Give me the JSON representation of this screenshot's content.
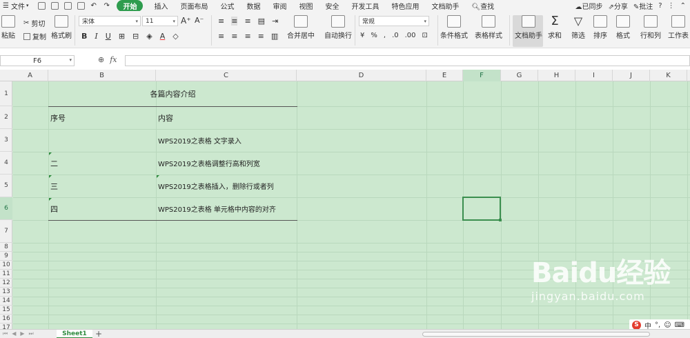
{
  "menubar": {
    "file_label": "文件",
    "start_tab": "开始",
    "tabs": [
      "插入",
      "页面布局",
      "公式",
      "数据",
      "审阅",
      "视图",
      "安全",
      "开发工具",
      "特色应用",
      "文档助手"
    ],
    "search_label": "查找",
    "sync_label": "已同步",
    "share_label": "分享",
    "comment_label": "批注",
    "help_label": "?"
  },
  "ribbon": {
    "paste_label": "粘贴",
    "cut_label": "剪切",
    "copy_label": "复制",
    "format_painter_label": "格式刷",
    "font_name": "宋体",
    "font_size": "11",
    "bold": "B",
    "italic": "I",
    "underline": "U",
    "merge_label": "合并居中",
    "wrap_label": "自动换行",
    "number_format": "常规",
    "cond_format_label": "条件格式",
    "table_style_label": "表格样式",
    "doc_helper_label": "文档助手",
    "sum_label": "求和",
    "filter_label": "筛选",
    "sort_label": "排序",
    "format_label": "格式",
    "rowcol_label": "行和列",
    "worksheet_label": "工作表"
  },
  "formula_bar": {
    "cell_ref": "F6",
    "fx": "fx",
    "value": ""
  },
  "sheet": {
    "columns": [
      "A",
      "B",
      "C",
      "D",
      "E",
      "F",
      "G",
      "H",
      "I",
      "J",
      "K"
    ],
    "selected_column": "F",
    "rows": [
      "1",
      "2",
      "3",
      "4",
      "5",
      "6",
      "7",
      "8",
      "9",
      "10",
      "11",
      "12",
      "13",
      "14",
      "15",
      "16",
      "17"
    ],
    "selected_row": "6",
    "title": "各篇内容介绍",
    "header_no": "序号",
    "header_content": "内容",
    "entries": [
      {
        "no": "",
        "content": "WPS2019之表格 文字录入"
      },
      {
        "no": "二",
        "content": "WPS2019之表格调整行高和列宽"
      },
      {
        "no": "三",
        "content": "WPS2019之表格插入，删除行或者列"
      },
      {
        "no": "四",
        "content": "WPS2019之表格   单元格中内容的对齐"
      }
    ],
    "grid_color": "#b9d8bd",
    "background_color": "#cce8cf"
  },
  "status": {
    "sheet_tab": "Sheet1",
    "add_sheet": "+"
  },
  "watermark": {
    "main": "Baidu经验",
    "sub": "jingyan.baidu.com"
  },
  "ime": {
    "label": "中"
  }
}
